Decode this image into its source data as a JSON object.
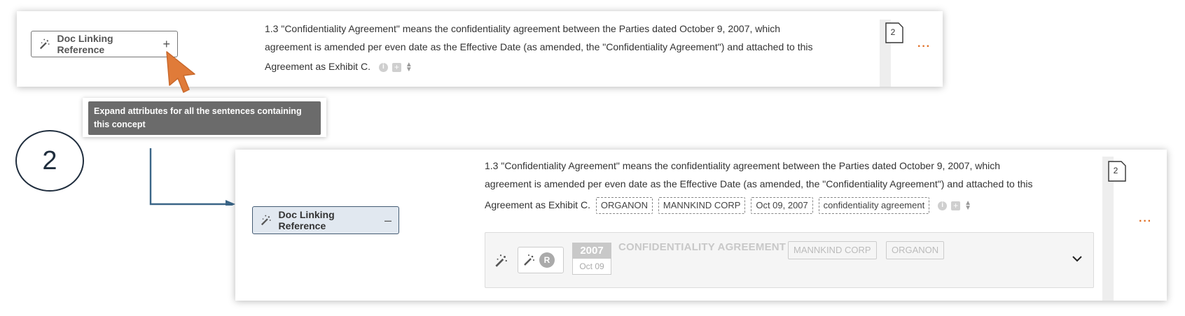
{
  "step_number": "2",
  "tooltip": {
    "text": "Expand attributes for all the sentences containing this concept"
  },
  "top_panel": {
    "pill": {
      "label": "Doc Linking Reference",
      "toggle": "+"
    },
    "sentence_lines": [
      "1.3 \"Confidentiality Agreement\" means the confidentiality agreement between the Parties dated October 9, 2007, which",
      "agreement is amended per even date as the Effective Date (as amended, the \"Confidentiality Agreement\") and attached to this",
      "Agreement as Exhibit C."
    ],
    "page_number": "2",
    "more_label": "···"
  },
  "bottom_panel": {
    "pill": {
      "label": "Doc Linking Reference",
      "toggle": "–"
    },
    "sentence_lines": [
      "1.3 \"Confidentiality Agreement\" means the confidentiality agreement between the Parties dated October 9, 2007, which",
      "agreement is amended per even date as the Effective Date (as amended, the \"Confidentiality Agreement\") and attached to this",
      "Agreement as Exhibit C."
    ],
    "tags": [
      "ORGANON",
      "MANNKIND CORP",
      "Oct 09, 2007",
      "confidentiality agreement"
    ],
    "page_number": "2",
    "more_label": "···",
    "attributes": {
      "r_label": "R",
      "date_year": "2007",
      "date_day": "Oct 09",
      "title": "CONFIDENTIALITY AGREEMENT",
      "tags": [
        "MANNKIND CORP",
        "ORGANON"
      ]
    }
  },
  "inline_icons": {
    "info": "i",
    "add": "+"
  },
  "colors": {
    "accent": "#e06b1f",
    "arrow": "#3a6587",
    "cursor": "#e07b39",
    "active_pill": "#e1e8f0"
  }
}
